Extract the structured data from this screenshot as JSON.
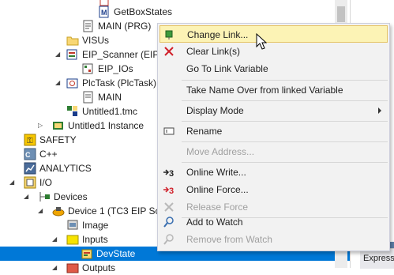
{
  "tree": {
    "items": [
      {
        "label": "GetBoxStates",
        "icon": "function-block-icon"
      },
      {
        "label": "MAIN (PRG)",
        "icon": "program-icon"
      },
      {
        "label": "VISUs",
        "icon": "folder-icon"
      },
      {
        "label": "EIP_Scanner (EIP_",
        "icon": "gvl-icon"
      },
      {
        "label": "EIP_IOs",
        "icon": "io-icon"
      },
      {
        "label": "PlcTask (PlcTask)",
        "icon": "task-icon"
      },
      {
        "label": "MAIN",
        "icon": "program-icon"
      },
      {
        "label": "Untitled1.tmc",
        "icon": "tmc-icon"
      },
      {
        "label": "Untitled1 Instance",
        "icon": "instance-icon"
      },
      {
        "label": "SAFETY",
        "icon": "safety-icon"
      },
      {
        "label": "C++",
        "icon": "cpp-icon"
      },
      {
        "label": "ANALYTICS",
        "icon": "analytics-icon"
      },
      {
        "label": "I/O",
        "icon": "io-folder-icon"
      },
      {
        "label": "Devices",
        "icon": "devices-icon"
      },
      {
        "label": "Device 1 (TC3 EIP Sca",
        "icon": "device-icon"
      },
      {
        "label": "Image",
        "icon": "image-icon"
      },
      {
        "label": "Inputs",
        "icon": "folder-icon"
      },
      {
        "label": "DevState",
        "icon": "variable-icon"
      },
      {
        "label": "Outputs",
        "icon": "folder-icon"
      }
    ]
  },
  "menu": {
    "items": [
      {
        "label": "Change Link...",
        "icon": "change-link-icon",
        "enabled": true
      },
      {
        "label": "Clear Link(s)",
        "icon": "clear-link-icon",
        "enabled": true
      },
      {
        "label": "Go To Link Variable",
        "icon": "",
        "enabled": true
      },
      {
        "label": "Take Name Over from linked Variable",
        "icon": "",
        "enabled": true
      },
      {
        "label": "Display Mode",
        "icon": "",
        "enabled": true
      },
      {
        "label": "Rename",
        "icon": "rename-icon",
        "enabled": true
      },
      {
        "label": "Move Address...",
        "icon": "",
        "enabled": false
      },
      {
        "label": "Online Write...",
        "icon": "online-write-icon",
        "enabled": true
      },
      {
        "label": "Online Force...",
        "icon": "online-force-icon",
        "enabled": true
      },
      {
        "label": "Release Force",
        "icon": "release-force-icon",
        "enabled": false
      },
      {
        "label": "Add to Watch",
        "icon": "add-watch-icon",
        "enabled": true
      },
      {
        "label": "Remove from Watch",
        "icon": "remove-watch-icon",
        "enabled": false
      }
    ]
  },
  "right_panel": {
    "tab_label": "Express"
  },
  "colors": {
    "selection": "#0078d7",
    "menu_hover": "#fcf3b5",
    "menu_bg": "#f2f2f2"
  }
}
